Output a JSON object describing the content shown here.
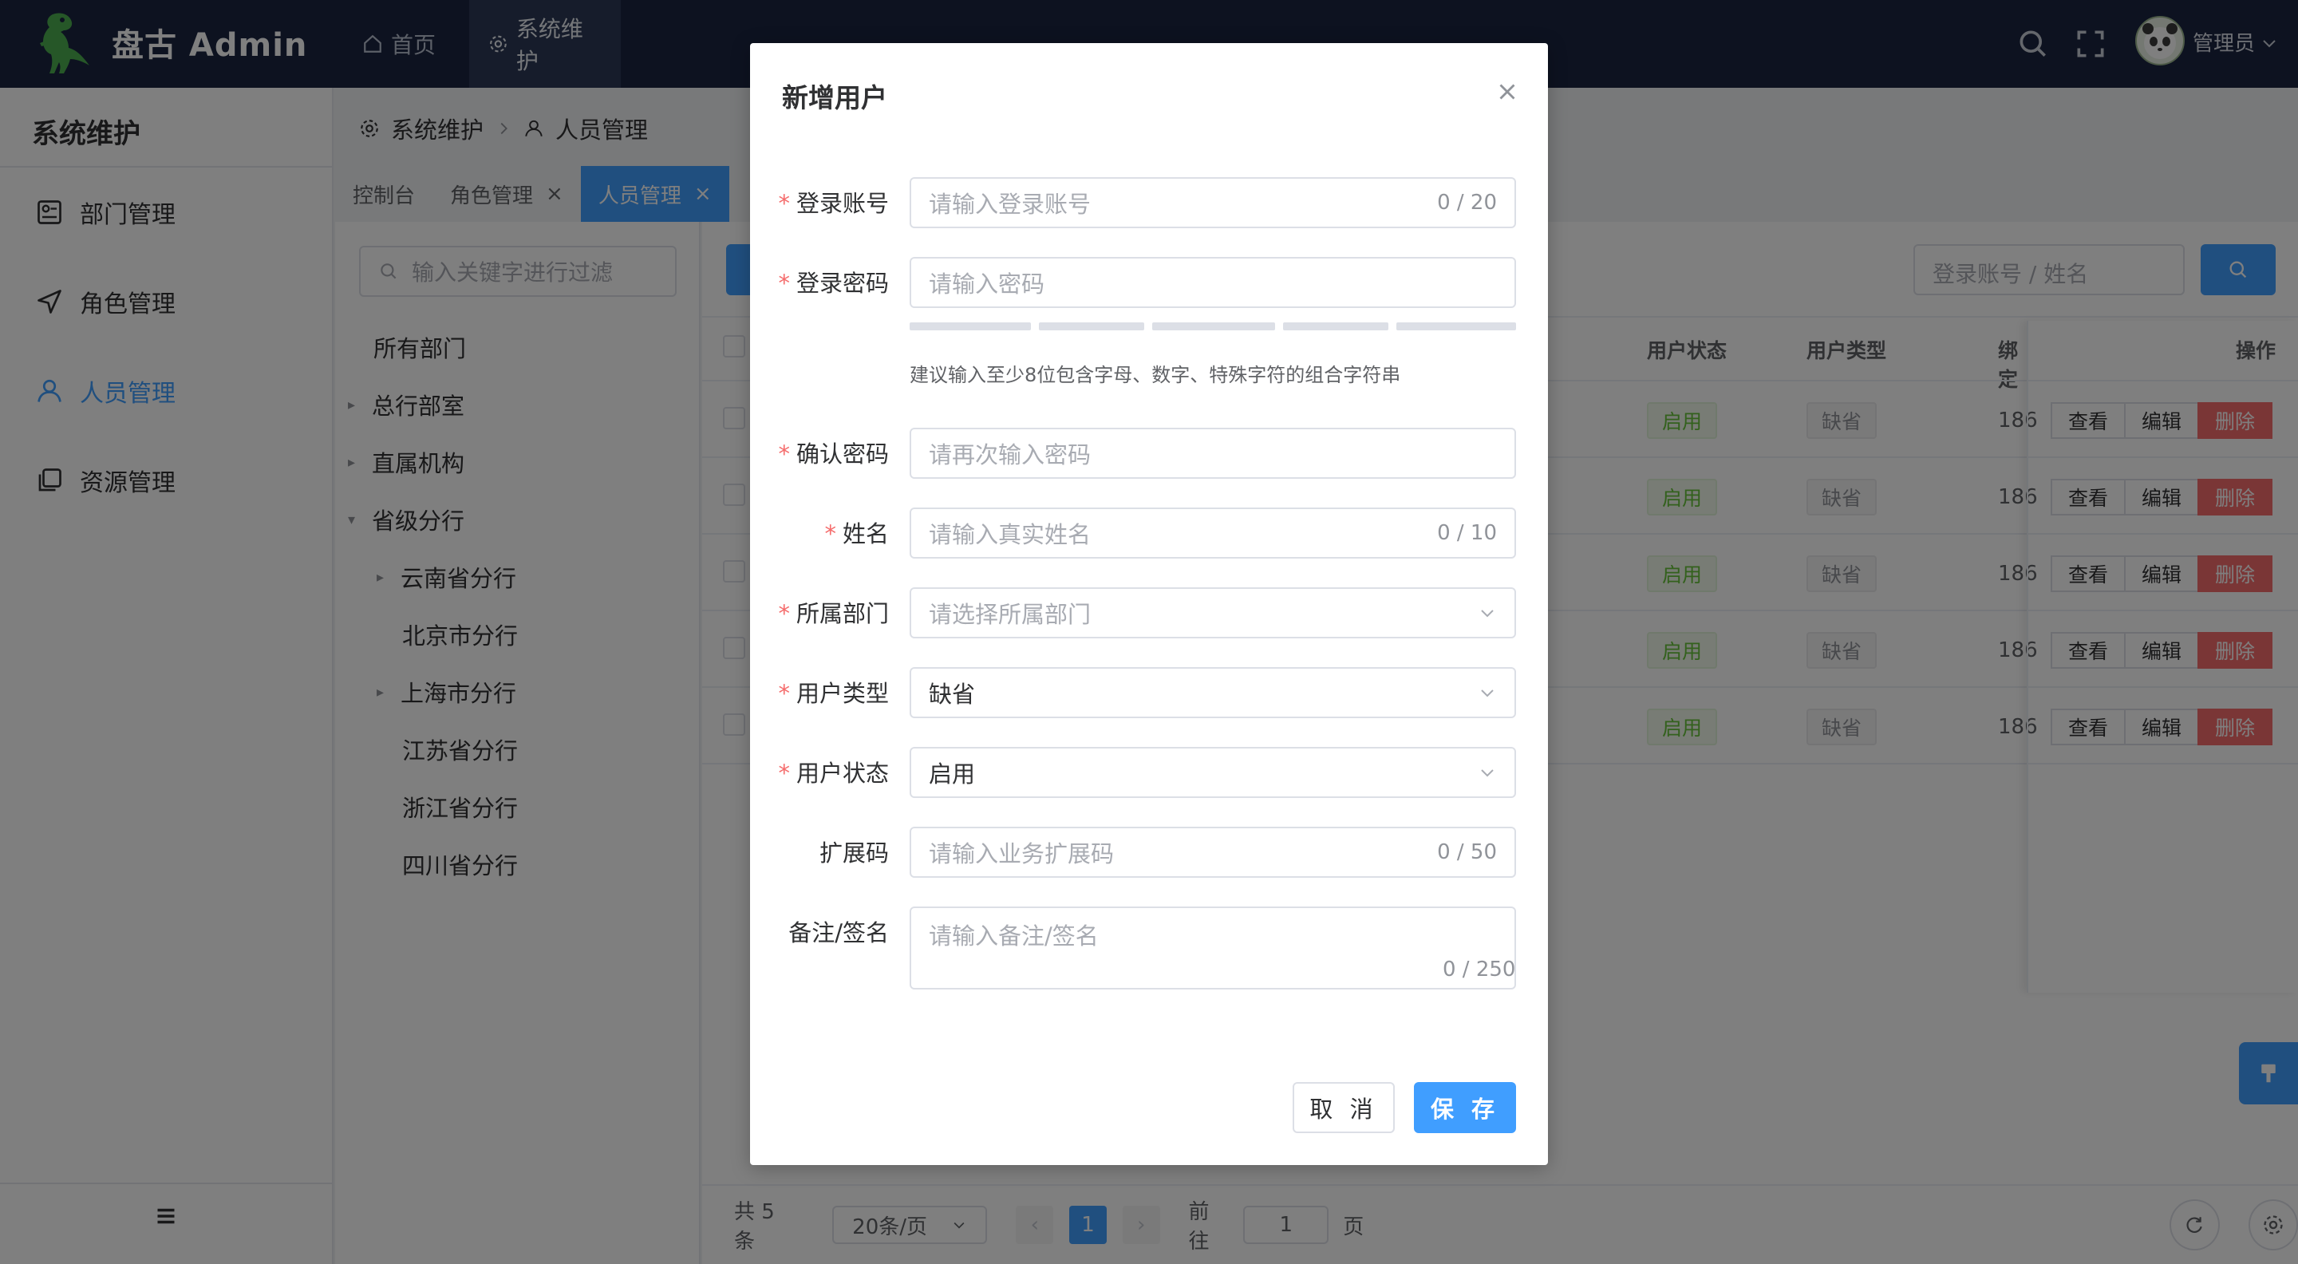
{
  "header": {
    "app_title": "盘古 Admin",
    "nav": [
      {
        "label": "首页",
        "icon": "home-icon"
      },
      {
        "label": "系统维护",
        "icon": "gear-icon"
      }
    ],
    "user_name": "管理员"
  },
  "sidebar": {
    "title": "系统维护",
    "items": [
      {
        "label": "部门管理",
        "icon": "department-icon"
      },
      {
        "label": "角色管理",
        "icon": "send-icon"
      },
      {
        "label": "人员管理",
        "icon": "user-icon"
      },
      {
        "label": "资源管理",
        "icon": "copy-icon"
      }
    ]
  },
  "breadcrumb": {
    "level1": "系统维护",
    "level2": "人员管理"
  },
  "tabs": [
    {
      "label": "控制台"
    },
    {
      "label": "角色管理"
    },
    {
      "label": "人员管理"
    }
  ],
  "tree": {
    "filter_placeholder": "输入关键字进行过滤",
    "nodes": [
      {
        "label": "所有部门"
      },
      {
        "label": "总行部室"
      },
      {
        "label": "直属机构"
      },
      {
        "label": "省级分行"
      },
      {
        "label": "云南省分行"
      },
      {
        "label": "北京市分行"
      },
      {
        "label": "上海市分行"
      },
      {
        "label": "江苏省分行"
      },
      {
        "label": "浙江省分行"
      },
      {
        "label": "四川省分行"
      }
    ]
  },
  "table": {
    "search_placeholder": "登录账号 / 姓名",
    "columns": {
      "status": "用户状态",
      "type": "用户类型",
      "bind": "绑定",
      "ops": "操作"
    },
    "rows": [
      {
        "status": "启用",
        "type": "缺省",
        "phone": "186"
      },
      {
        "status": "启用",
        "type": "缺省",
        "phone": "186"
      },
      {
        "status": "启用",
        "type": "缺省",
        "phone": "186"
      },
      {
        "status": "启用",
        "type": "缺省",
        "phone": "186"
      },
      {
        "status": "启用",
        "type": "缺省",
        "phone": "186"
      }
    ],
    "op_view": "查看",
    "op_edit": "编辑",
    "op_delete": "删除"
  },
  "pager": {
    "total": "共 5 条",
    "page_size": "20条/页",
    "current_page": "1",
    "goto_prefix": "前往",
    "goto_value": "1",
    "goto_suffix": "页"
  },
  "dialog": {
    "title": "新增用户",
    "fields": {
      "account": {
        "label": "登录账号",
        "placeholder": "请输入登录账号",
        "count": "0 / 20"
      },
      "password": {
        "label": "登录密码",
        "placeholder": "请输入密码",
        "hint": "建议输入至少8位包含字母、数字、特殊字符的组合字符串"
      },
      "confirm": {
        "label": "确认密码",
        "placeholder": "请再次输入密码"
      },
      "name": {
        "label": "姓名",
        "placeholder": "请输入真实姓名",
        "count": "0 / 10"
      },
      "dept": {
        "label": "所属部门",
        "placeholder": "请选择所属部门"
      },
      "user_type": {
        "label": "用户类型",
        "value": "缺省"
      },
      "user_status": {
        "label": "用户状态",
        "value": "启用"
      },
      "ext_code": {
        "label": "扩展码",
        "placeholder": "请输入业务扩展码",
        "count": "0 / 50"
      },
      "remark": {
        "label": "备注/签名",
        "placeholder": "请输入备注/签名",
        "count": "0 / 250"
      }
    },
    "cancel_label": "取 消",
    "save_label": "保 存"
  }
}
